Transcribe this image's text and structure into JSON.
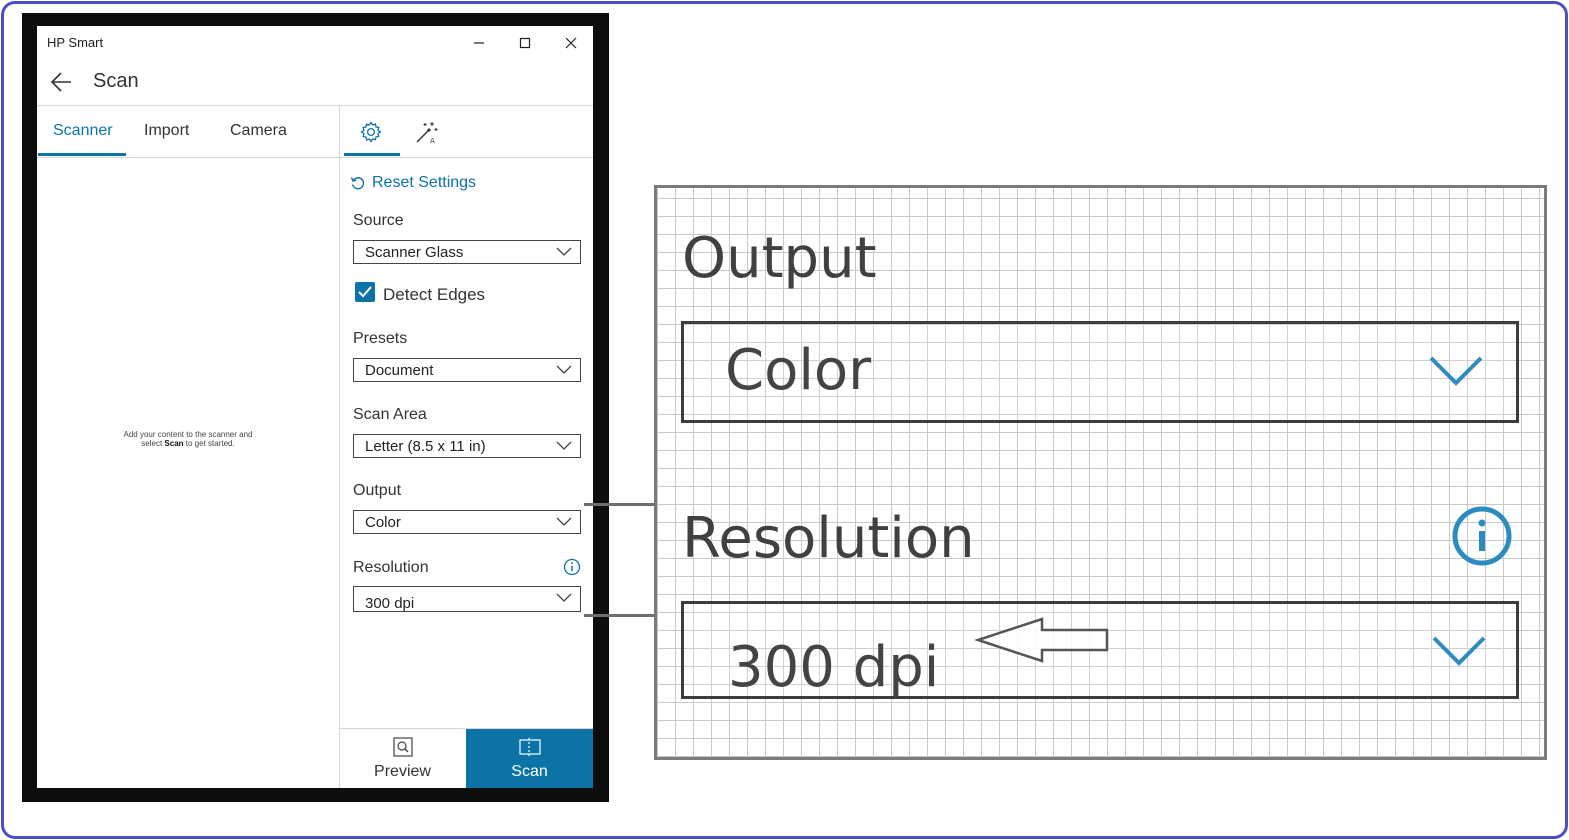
{
  "app": {
    "window_title": "HP Smart",
    "header_title": "Scan",
    "tabs": [
      "Scanner",
      "Import",
      "Camera"
    ],
    "active_tab": "Scanner",
    "empty_message_line1": "Add your content to the scanner and",
    "empty_message_pre": "select ",
    "empty_message_bold": "Scan",
    "empty_message_post": " to get started.",
    "settings": {
      "reset_label": "Reset Settings",
      "source_label": "Source",
      "source_value": "Scanner Glass",
      "detect_edges_label": "Detect Edges",
      "detect_edges_checked": true,
      "presets_label": "Presets",
      "presets_value": "Document",
      "scan_area_label": "Scan Area",
      "scan_area_value": "Letter (8.5 x 11 in)",
      "output_label": "Output",
      "output_value": "Color",
      "resolution_label": "Resolution",
      "resolution_value": "300 dpi"
    },
    "buttons": {
      "preview": "Preview",
      "scan": "Scan"
    },
    "colors": {
      "accent": "#0b73a6",
      "frame": "#4a4fc4"
    }
  },
  "zoom": {
    "output_label": "Output",
    "output_value": "Color",
    "resolution_label": "Resolution",
    "resolution_value": "300 dpi"
  }
}
